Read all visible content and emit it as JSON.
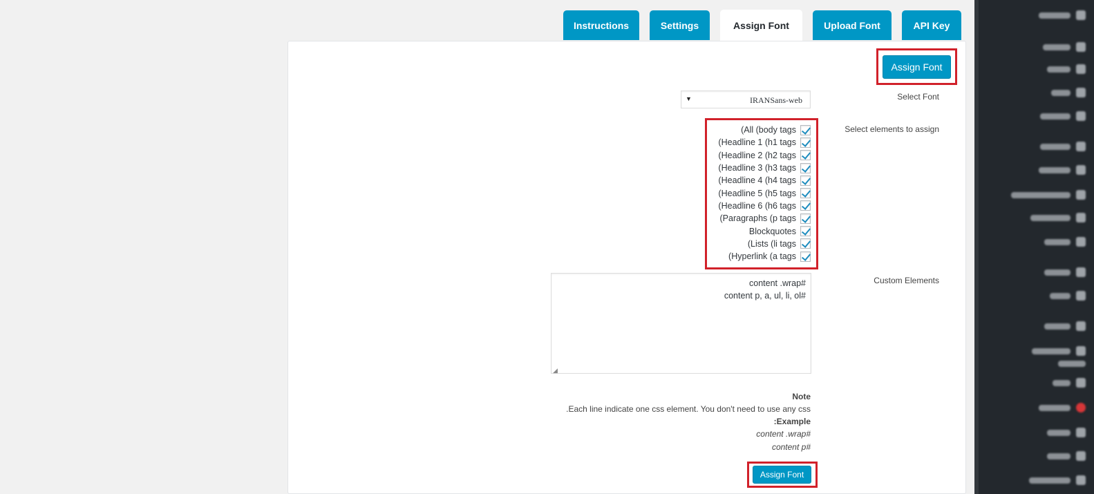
{
  "tabs": [
    {
      "label": "Instructions",
      "active": false
    },
    {
      "label": "Settings",
      "active": false
    },
    {
      "label": "Assign Font",
      "active": true
    },
    {
      "label": "Upload Font",
      "active": false
    },
    {
      "label": "API Key",
      "active": false
    }
  ],
  "header": {
    "assign_button_label": "Assign Font"
  },
  "form": {
    "select_font_label": "Select Font",
    "select_font_value": "IRANSans-web",
    "select_font_arrow": "▼",
    "elements_label": "Select elements to assign",
    "elements": [
      {
        "label": "(All (body tags",
        "checked": true
      },
      {
        "label": "(Headline 1 (h1 tags",
        "checked": true
      },
      {
        "label": "(Headline 2 (h2 tags",
        "checked": true
      },
      {
        "label": "(Headline 3 (h3 tags",
        "checked": true
      },
      {
        "label": "(Headline 4 (h4 tags",
        "checked": true
      },
      {
        "label": "(Headline 5 (h5 tags",
        "checked": true
      },
      {
        "label": "(Headline 6 (h6 tags",
        "checked": true
      },
      {
        "label": "(Paragraphs (p tags",
        "checked": true
      },
      {
        "label": "Blockquotes",
        "checked": true
      },
      {
        "label": "(Lists (li tags",
        "checked": true
      },
      {
        "label": "(Hyperlink (a tags",
        "checked": true
      }
    ],
    "custom_label": "Custom Elements",
    "custom_lines": [
      "content .wrap#",
      "content p, a, ul, li, ol#"
    ]
  },
  "note": {
    "title": "Note",
    "text": ".Each line indicate one css element. You don't need to use any css",
    "example_title": ":Example",
    "example_lines": [
      "content .wrap#",
      "content p#"
    ]
  },
  "footer": {
    "assign_button_label": "Assign Font"
  },
  "colors": {
    "accent": "#0097c5",
    "highlight": "#d1212a",
    "sidebar": "#23282d"
  }
}
